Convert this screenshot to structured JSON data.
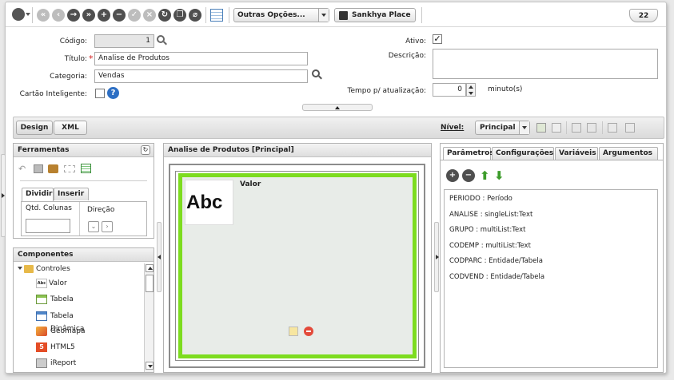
{
  "toolbar": {
    "other_options": "Outras Opções...",
    "sankhya_place": "Sankhya Place",
    "counter": "22"
  },
  "form": {
    "codigo_label": "Código:",
    "codigo_value": "1",
    "titulo_label": "Título:",
    "titulo_value": "Analise de Produtos",
    "categoria_label": "Categoria:",
    "categoria_value": "Vendas",
    "cartao_label": "Cartão Inteligente:",
    "ativo_label": "Ativo:",
    "descricao_label": "Descrição:",
    "tempo_label": "Tempo p/ atualização:",
    "tempo_value": "0",
    "tempo_unit": "minuto(s)"
  },
  "mode_tabs": {
    "design": "Design",
    "xml": "XML"
  },
  "nivel": {
    "label": "Nível:",
    "value": "Principal"
  },
  "ferramentas": {
    "title": "Ferramentas",
    "tabs": [
      "Dividir",
      "Inserir"
    ],
    "qtd_colunas": "Qtd. Colunas",
    "direcao": "Direção"
  },
  "componentes": {
    "title": "Componentes",
    "root": "Controles",
    "items": [
      {
        "label": "Valor",
        "icon": "abc-icon"
      },
      {
        "label": "Tabela",
        "icon": "table-icon"
      },
      {
        "label": "Tabela Dinâmica",
        "icon": "pivot-table-icon"
      },
      {
        "label": "Geomapa",
        "icon": "map-pin-icon"
      },
      {
        "label": "HTML5",
        "icon": "html5-icon"
      },
      {
        "label": "iReport",
        "icon": "report-icon"
      }
    ]
  },
  "canvas": {
    "title": "Analise de Produtos [Principal]",
    "widget_title": "Valor",
    "widget_icon_text": "Abc"
  },
  "params_panel": {
    "tabs": [
      "Parâmetros",
      "Configurações",
      "Variáveis",
      "Argumentos"
    ],
    "items": [
      "PERIODO : Período",
      "ANALISE : singleList:Text",
      "GRUPO : multiList:Text",
      "CODEMP : multiList:Text",
      "CODPARC : Entidade/Tabela",
      "CODVEND : Entidade/Tabela"
    ]
  },
  "colors": {
    "accent_green": "#7ddc1f",
    "help_blue": "#2d6fc4",
    "required_red": "#d31e1e"
  }
}
